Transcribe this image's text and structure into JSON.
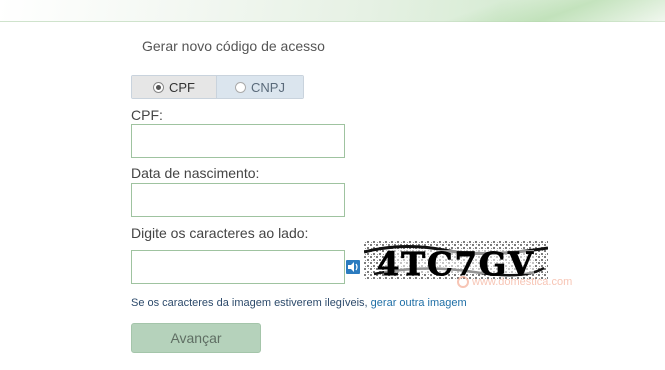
{
  "page": {
    "title": "Gerar novo código de acesso"
  },
  "person_type": {
    "options": [
      {
        "label": "CPF",
        "selected": true
      },
      {
        "label": "CNPJ",
        "selected": false
      }
    ]
  },
  "form": {
    "cpf_label": "CPF:",
    "cpf_value": "",
    "birthdate_label": "Data de nascimento:",
    "birthdate_value": "",
    "captcha_label": "Digite os caracteres ao lado:",
    "captcha_value": "",
    "captcha_text": "4TC7GV",
    "captcha_hint": "Se os caracteres da imagem estiverem ilegíveis,",
    "captcha_refresh_link": "gerar outra imagem",
    "submit_label": "Avançar"
  },
  "watermark": {
    "text": "www.domestica.com"
  },
  "icons": {
    "audio": "speaker-icon"
  },
  "colors": {
    "input_border": "#9fc3a0",
    "button_bg": "#b5d2bb",
    "link": "#1f6fa6",
    "banner": "#d8ecd5"
  }
}
